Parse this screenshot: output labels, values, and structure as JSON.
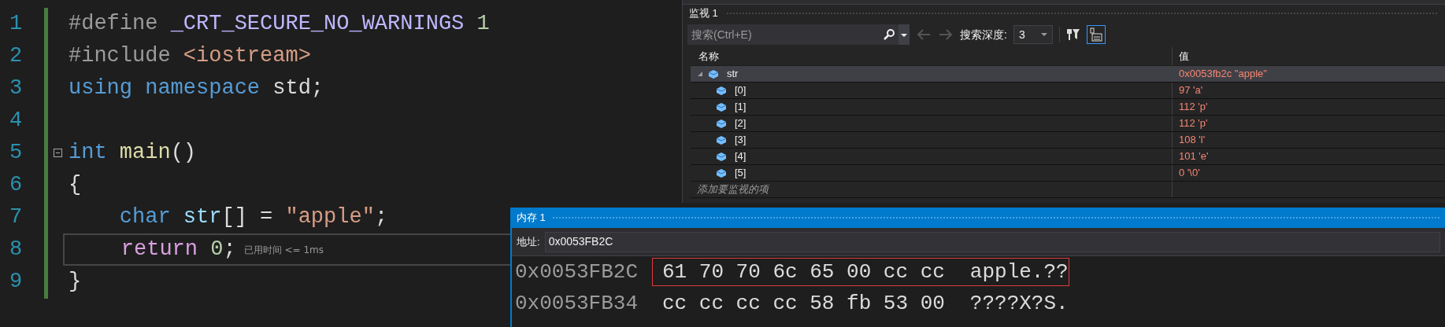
{
  "editor": {
    "lines": [
      {
        "number": "1",
        "tokens": [
          {
            "text": "#define ",
            "kind": "directive"
          },
          {
            "text": "_CRT_SECURE_NO_WARNINGS ",
            "kind": "macro"
          },
          {
            "text": "1",
            "kind": "number"
          }
        ]
      },
      {
        "number": "2",
        "tokens": [
          {
            "text": "#include ",
            "kind": "directive"
          },
          {
            "text": "<iostream>",
            "kind": "string"
          }
        ]
      },
      {
        "number": "3",
        "tokens": [
          {
            "text": "using ",
            "kind": "keyword"
          },
          {
            "text": "namespace",
            "kind": "keyword"
          },
          {
            "text": " std;",
            "kind": "plain"
          }
        ]
      },
      {
        "number": "4"
      },
      {
        "number": "5",
        "collapsible": true,
        "tokens": [
          {
            "text": "int ",
            "kind": "keyword"
          },
          {
            "text": "main",
            "kind": "function"
          },
          {
            "text": "()",
            "kind": "plain"
          }
        ]
      },
      {
        "number": "6",
        "tokens": [
          {
            "text": "{",
            "kind": "plain"
          }
        ]
      },
      {
        "number": "7",
        "tokens": [
          {
            "text": "    char ",
            "kind": "keyword"
          },
          {
            "text": "str",
            "kind": "variable"
          },
          {
            "text": "[] = ",
            "kind": "plain"
          },
          {
            "text": "\"apple\"",
            "kind": "string"
          },
          {
            "text": ";",
            "kind": "plain"
          }
        ]
      },
      {
        "number": "8",
        "current": true,
        "hint": "已用时间 <= 1ms",
        "tokens": [
          {
            "text": "    return ",
            "kind": "control"
          },
          {
            "text": "0",
            "kind": "number"
          },
          {
            "text": ";",
            "kind": "plain"
          }
        ]
      },
      {
        "number": "9",
        "tokens": [
          {
            "text": "}",
            "kind": "plain"
          }
        ]
      }
    ]
  },
  "watch": {
    "title": "监视 1",
    "search": {
      "placeholder": "搜索(Ctrl+E)"
    },
    "depth_label": "搜索深度:",
    "depth": "3",
    "columns": [
      "名称",
      "值"
    ],
    "rows": [
      {
        "name": "str",
        "value": "0x0053fb2c \"apple\"",
        "expanded": true,
        "selected": true,
        "children": [
          {
            "name": "[0]",
            "value": "97 'a'",
            "selected": false
          },
          {
            "name": "[1]",
            "value": "112 'p'",
            "selected": false
          },
          {
            "name": "[2]",
            "value": "112 'p'",
            "selected": false
          },
          {
            "name": "[3]",
            "value": "108 'l'",
            "selected": false
          },
          {
            "name": "[4]",
            "value": "101 'e'",
            "selected": false
          },
          {
            "name": "[5]",
            "value": "0 '\\0'",
            "selected": false
          }
        ]
      }
    ],
    "add_placeholder": "添加要监视的项"
  },
  "memory": {
    "title": "内存 1",
    "address_label": "地址:",
    "address": "0x0053FB2C",
    "rows": [
      {
        "address": "0x0053FB2C",
        "bytes": "61 70 70 6c 65 00 cc cc",
        "text": "apple.??",
        "highlighted": true
      },
      {
        "address": "0x0053FB34",
        "bytes": "cc cc cc cc 58 fb 53 00",
        "text": "????X?S.",
        "highlighted": false
      }
    ]
  }
}
